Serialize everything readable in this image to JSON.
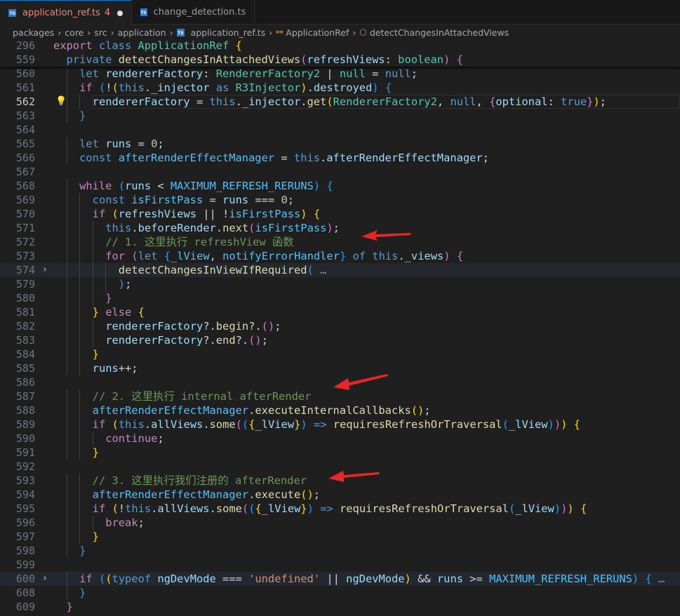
{
  "tabs": [
    {
      "label": "application_ref.ts",
      "problems": "4",
      "active": true,
      "modified": true
    },
    {
      "label": "change_detection.ts",
      "active": false
    }
  ],
  "breadcrumb": [
    "packages",
    "core",
    "src",
    "application",
    "application_ref.ts",
    "ApplicationRef",
    "detectChangesInAttachedViews"
  ],
  "theme": {
    "background": "#1f1f1f",
    "kw": "#569cd6",
    "ctrl": "#c586c0",
    "type": "#4ec9b0",
    "fn": "#dcdcaa",
    "var": "#9cdcfe",
    "const": "#4fc1ff",
    "num": "#b5cea8",
    "str": "#ce9178",
    "com": "#6a9955",
    "b1": "#ffd700",
    "b2": "#da70d6",
    "b3": "#179fff",
    "plain": "#d4d4d4",
    "fold": "#8c8c8c",
    "arrow": "#e8262a"
  },
  "sticky": [
    {
      "n": "296",
      "i": 0,
      "t": [
        [
          "export",
          "ctrl"
        ],
        [
          " class",
          "kw"
        ],
        [
          " ApplicationRef",
          "type"
        ],
        [
          " {",
          "b1"
        ]
      ]
    },
    {
      "n": "559",
      "i": 2,
      "t": [
        [
          "private",
          "kw"
        ],
        [
          " detectChangesInAttachedViews",
          "fn"
        ],
        [
          "(",
          "b2"
        ],
        [
          "refreshViews",
          "var"
        ],
        [
          ": ",
          "plain"
        ],
        [
          "boolean",
          "type"
        ],
        [
          ")",
          "b2"
        ],
        [
          " {",
          "b2"
        ]
      ]
    }
  ],
  "lines": [
    {
      "n": "560",
      "i": 4,
      "t": [
        [
          "let",
          "kw"
        ],
        [
          " rendererFactory",
          "var"
        ],
        [
          ": ",
          "plain"
        ],
        [
          "RendererFactory2",
          "type"
        ],
        [
          " | ",
          "plain"
        ],
        [
          "null",
          "type"
        ],
        [
          " = ",
          "plain"
        ],
        [
          "null",
          "kw"
        ],
        [
          ";",
          "plain"
        ]
      ]
    },
    {
      "n": "561",
      "i": 4,
      "t": [
        [
          "if",
          "ctrl"
        ],
        [
          " ",
          "plain"
        ],
        [
          "(",
          "b3"
        ],
        [
          "!",
          "plain"
        ],
        [
          "(",
          "b1"
        ],
        [
          "this",
          "kw"
        ],
        [
          ".",
          "plain"
        ],
        [
          "_injector",
          "var"
        ],
        [
          " as",
          "kw"
        ],
        [
          " R3Injector",
          "type"
        ],
        [
          ")",
          "b1"
        ],
        [
          ".",
          "plain"
        ],
        [
          "destroyed",
          "var"
        ],
        [
          ")",
          "b3"
        ],
        [
          " ",
          "plain"
        ],
        [
          "{",
          "b3"
        ]
      ]
    },
    {
      "n": "562",
      "i": 6,
      "cur": true,
      "bulb": true,
      "t": [
        [
          "rendererFactory",
          "var"
        ],
        [
          " = ",
          "plain"
        ],
        [
          "this",
          "kw"
        ],
        [
          ".",
          "plain"
        ],
        [
          "_injector",
          "var"
        ],
        [
          ".",
          "plain"
        ],
        [
          "get",
          "fn"
        ],
        [
          "(",
          "b1"
        ],
        [
          "RendererFactory2",
          "type"
        ],
        [
          ", ",
          "plain"
        ],
        [
          "null",
          "kw"
        ],
        [
          ", ",
          "plain"
        ],
        [
          "{",
          "b2"
        ],
        [
          "optional",
          "var"
        ],
        [
          ": ",
          "plain"
        ],
        [
          "true",
          "kw"
        ],
        [
          "}",
          "b2"
        ],
        [
          ")",
          "b1"
        ],
        [
          ";",
          "plain"
        ]
      ]
    },
    {
      "n": "563",
      "i": 4,
      "t": [
        [
          "}",
          "b3"
        ]
      ]
    },
    {
      "n": "564",
      "i": 0,
      "t": []
    },
    {
      "n": "565",
      "i": 4,
      "t": [
        [
          "let",
          "kw"
        ],
        [
          " runs",
          "var"
        ],
        [
          " = ",
          "plain"
        ],
        [
          "0",
          "num"
        ],
        [
          ";",
          "plain"
        ]
      ]
    },
    {
      "n": "566",
      "i": 4,
      "t": [
        [
          "const",
          "kw"
        ],
        [
          " afterRenderEffectManager",
          "const"
        ],
        [
          " = ",
          "plain"
        ],
        [
          "this",
          "kw"
        ],
        [
          ".",
          "plain"
        ],
        [
          "afterRenderEffectManager",
          "var"
        ],
        [
          ";",
          "plain"
        ]
      ]
    },
    {
      "n": "567",
      "i": 0,
      "t": []
    },
    {
      "n": "568",
      "i": 4,
      "t": [
        [
          "while",
          "ctrl"
        ],
        [
          " ",
          "plain"
        ],
        [
          "(",
          "b3"
        ],
        [
          "runs",
          "var"
        ],
        [
          " < ",
          "plain"
        ],
        [
          "MAXIMUM_REFRESH_RERUNS",
          "const"
        ],
        [
          ")",
          "b3"
        ],
        [
          " {",
          "b3"
        ]
      ]
    },
    {
      "n": "569",
      "i": 6,
      "t": [
        [
          "const",
          "kw"
        ],
        [
          " isFirstPass",
          "const"
        ],
        [
          " = ",
          "plain"
        ],
        [
          "runs",
          "var"
        ],
        [
          " === ",
          "plain"
        ],
        [
          "0",
          "num"
        ],
        [
          ";",
          "plain"
        ]
      ]
    },
    {
      "n": "570",
      "i": 6,
      "t": [
        [
          "if",
          "ctrl"
        ],
        [
          " ",
          "plain"
        ],
        [
          "(",
          "b1"
        ],
        [
          "refreshViews",
          "var"
        ],
        [
          " || !",
          "plain"
        ],
        [
          "isFirstPass",
          "const"
        ],
        [
          ")",
          "b1"
        ],
        [
          " {",
          "b1"
        ]
      ]
    },
    {
      "n": "571",
      "i": 8,
      "t": [
        [
          "this",
          "kw"
        ],
        [
          ".",
          "plain"
        ],
        [
          "beforeRender",
          "var"
        ],
        [
          ".",
          "plain"
        ],
        [
          "next",
          "fn"
        ],
        [
          "(",
          "b2"
        ],
        [
          "isFirstPass",
          "const"
        ],
        [
          ")",
          "b2"
        ],
        [
          ";",
          "plain"
        ]
      ]
    },
    {
      "n": "572",
      "i": 8,
      "t": [
        [
          "// 1. 这里执行 refreshView 函数",
          "com"
        ]
      ]
    },
    {
      "n": "573",
      "i": 8,
      "t": [
        [
          "for",
          "ctrl"
        ],
        [
          " ",
          "plain"
        ],
        [
          "(",
          "b2"
        ],
        [
          "let",
          "kw"
        ],
        [
          " ",
          "plain"
        ],
        [
          "{",
          "b3"
        ],
        [
          "_lView",
          "const"
        ],
        [
          ", ",
          "plain"
        ],
        [
          "notifyErrorHandler",
          "const"
        ],
        [
          "}",
          "b3"
        ],
        [
          " of",
          "kw"
        ],
        [
          " this",
          "kw"
        ],
        [
          ".",
          "plain"
        ],
        [
          "_views",
          "var"
        ],
        [
          ")",
          "b2"
        ],
        [
          " {",
          "b2"
        ]
      ]
    },
    {
      "n": "574",
      "i": 10,
      "hl": true,
      "fold": true,
      "t": [
        [
          "detectChangesInViewIfRequired",
          "fn"
        ],
        [
          "(",
          "b3"
        ],
        [
          " …",
          "fold"
        ]
      ]
    },
    {
      "n": "579",
      "i": 10,
      "t": [
        [
          ")",
          "b3"
        ],
        [
          ";",
          "plain"
        ]
      ]
    },
    {
      "n": "580",
      "i": 8,
      "t": [
        [
          "}",
          "b2"
        ]
      ]
    },
    {
      "n": "581",
      "i": 6,
      "t": [
        [
          "}",
          "b1"
        ],
        [
          " else",
          "ctrl"
        ],
        [
          " {",
          "b1"
        ]
      ]
    },
    {
      "n": "582",
      "i": 8,
      "t": [
        [
          "rendererFactory",
          "var"
        ],
        [
          "?.",
          "plain"
        ],
        [
          "begin",
          "fn"
        ],
        [
          "?.",
          "plain"
        ],
        [
          "(",
          "b2"
        ],
        [
          ")",
          "b2"
        ],
        [
          ";",
          "plain"
        ]
      ]
    },
    {
      "n": "583",
      "i": 8,
      "t": [
        [
          "rendererFactory",
          "var"
        ],
        [
          "?.",
          "plain"
        ],
        [
          "end",
          "fn"
        ],
        [
          "?.",
          "plain"
        ],
        [
          "(",
          "b2"
        ],
        [
          ")",
          "b2"
        ],
        [
          ";",
          "plain"
        ]
      ]
    },
    {
      "n": "584",
      "i": 6,
      "t": [
        [
          "}",
          "b1"
        ]
      ]
    },
    {
      "n": "585",
      "i": 6,
      "t": [
        [
          "runs",
          "var"
        ],
        [
          "++;",
          "plain"
        ]
      ]
    },
    {
      "n": "586",
      "i": 0,
      "t": []
    },
    {
      "n": "587",
      "i": 6,
      "t": [
        [
          "// 2. 这里执行 internal afterRender",
          "com"
        ]
      ]
    },
    {
      "n": "588",
      "i": 6,
      "t": [
        [
          "afterRenderEffectManager",
          "const"
        ],
        [
          ".",
          "plain"
        ],
        [
          "executeInternalCallbacks",
          "fn"
        ],
        [
          "(",
          "b1"
        ],
        [
          ")",
          "b1"
        ],
        [
          ";",
          "plain"
        ]
      ]
    },
    {
      "n": "589",
      "i": 6,
      "t": [
        [
          "if",
          "ctrl"
        ],
        [
          " ",
          "plain"
        ],
        [
          "(",
          "b1"
        ],
        [
          "this",
          "kw"
        ],
        [
          ".",
          "plain"
        ],
        [
          "allViews",
          "var"
        ],
        [
          ".",
          "plain"
        ],
        [
          "some",
          "fn"
        ],
        [
          "(",
          "b2"
        ],
        [
          "(",
          "b3"
        ],
        [
          "{",
          "b1"
        ],
        [
          "_lView",
          "var"
        ],
        [
          "}",
          "b1"
        ],
        [
          ")",
          "b3"
        ],
        [
          " => ",
          "kw"
        ],
        [
          "requiresRefreshOrTraversal",
          "fn"
        ],
        [
          "(",
          "b3"
        ],
        [
          "_lView",
          "var"
        ],
        [
          ")",
          "b3"
        ],
        [
          ")",
          "b2"
        ],
        [
          ")",
          "b1"
        ],
        [
          " {",
          "b1"
        ]
      ]
    },
    {
      "n": "590",
      "i": 8,
      "t": [
        [
          "continue",
          "ctrl"
        ],
        [
          ";",
          "plain"
        ]
      ]
    },
    {
      "n": "591",
      "i": 6,
      "t": [
        [
          "}",
          "b1"
        ]
      ]
    },
    {
      "n": "592",
      "i": 0,
      "t": []
    },
    {
      "n": "593",
      "i": 6,
      "t": [
        [
          "// 3. 这里执行我们注册的 afterRender",
          "com"
        ]
      ]
    },
    {
      "n": "594",
      "i": 6,
      "t": [
        [
          "afterRenderEffectManager",
          "const"
        ],
        [
          ".",
          "plain"
        ],
        [
          "execute",
          "fn"
        ],
        [
          "(",
          "b1"
        ],
        [
          ")",
          "b1"
        ],
        [
          ";",
          "plain"
        ]
      ]
    },
    {
      "n": "595",
      "i": 6,
      "t": [
        [
          "if",
          "ctrl"
        ],
        [
          " ",
          "plain"
        ],
        [
          "(",
          "b1"
        ],
        [
          "!",
          "plain"
        ],
        [
          "this",
          "kw"
        ],
        [
          ".",
          "plain"
        ],
        [
          "allViews",
          "var"
        ],
        [
          ".",
          "plain"
        ],
        [
          "some",
          "fn"
        ],
        [
          "(",
          "b2"
        ],
        [
          "(",
          "b3"
        ],
        [
          "{",
          "b1"
        ],
        [
          "_lView",
          "var"
        ],
        [
          "}",
          "b1"
        ],
        [
          ")",
          "b3"
        ],
        [
          " => ",
          "kw"
        ],
        [
          "requiresRefreshOrTraversal",
          "fn"
        ],
        [
          "(",
          "b3"
        ],
        [
          "_lView",
          "var"
        ],
        [
          ")",
          "b3"
        ],
        [
          ")",
          "b2"
        ],
        [
          ")",
          "b1"
        ],
        [
          " {",
          "b1"
        ]
      ]
    },
    {
      "n": "596",
      "i": 8,
      "t": [
        [
          "break",
          "ctrl"
        ],
        [
          ";",
          "plain"
        ]
      ]
    },
    {
      "n": "597",
      "i": 6,
      "t": [
        [
          "}",
          "b1"
        ]
      ]
    },
    {
      "n": "598",
      "i": 4,
      "t": [
        [
          "}",
          "b3"
        ]
      ]
    },
    {
      "n": "599",
      "i": 0,
      "t": []
    },
    {
      "n": "600",
      "i": 4,
      "hl": true,
      "fold": true,
      "t": [
        [
          "if",
          "ctrl"
        ],
        [
          " ",
          "plain"
        ],
        [
          "(",
          "b3"
        ],
        [
          "(",
          "b1"
        ],
        [
          "typeof",
          "kw"
        ],
        [
          " ngDevMode",
          "var"
        ],
        [
          " === ",
          "plain"
        ],
        [
          "'undefined'",
          "str"
        ],
        [
          " || ",
          "plain"
        ],
        [
          "ngDevMode",
          "var"
        ],
        [
          ")",
          "b1"
        ],
        [
          " && ",
          "plain"
        ],
        [
          "runs",
          "var"
        ],
        [
          " >= ",
          "plain"
        ],
        [
          "MAXIMUM_REFRESH_RERUNS",
          "const"
        ],
        [
          ")",
          "b3"
        ],
        [
          " {",
          "b3"
        ],
        [
          " …",
          "fold"
        ]
      ]
    },
    {
      "n": "608",
      "i": 4,
      "t": [
        [
          "}",
          "b3"
        ]
      ]
    },
    {
      "n": "609",
      "i": 2,
      "t": [
        [
          "}",
          "b2"
        ]
      ]
    }
  ]
}
